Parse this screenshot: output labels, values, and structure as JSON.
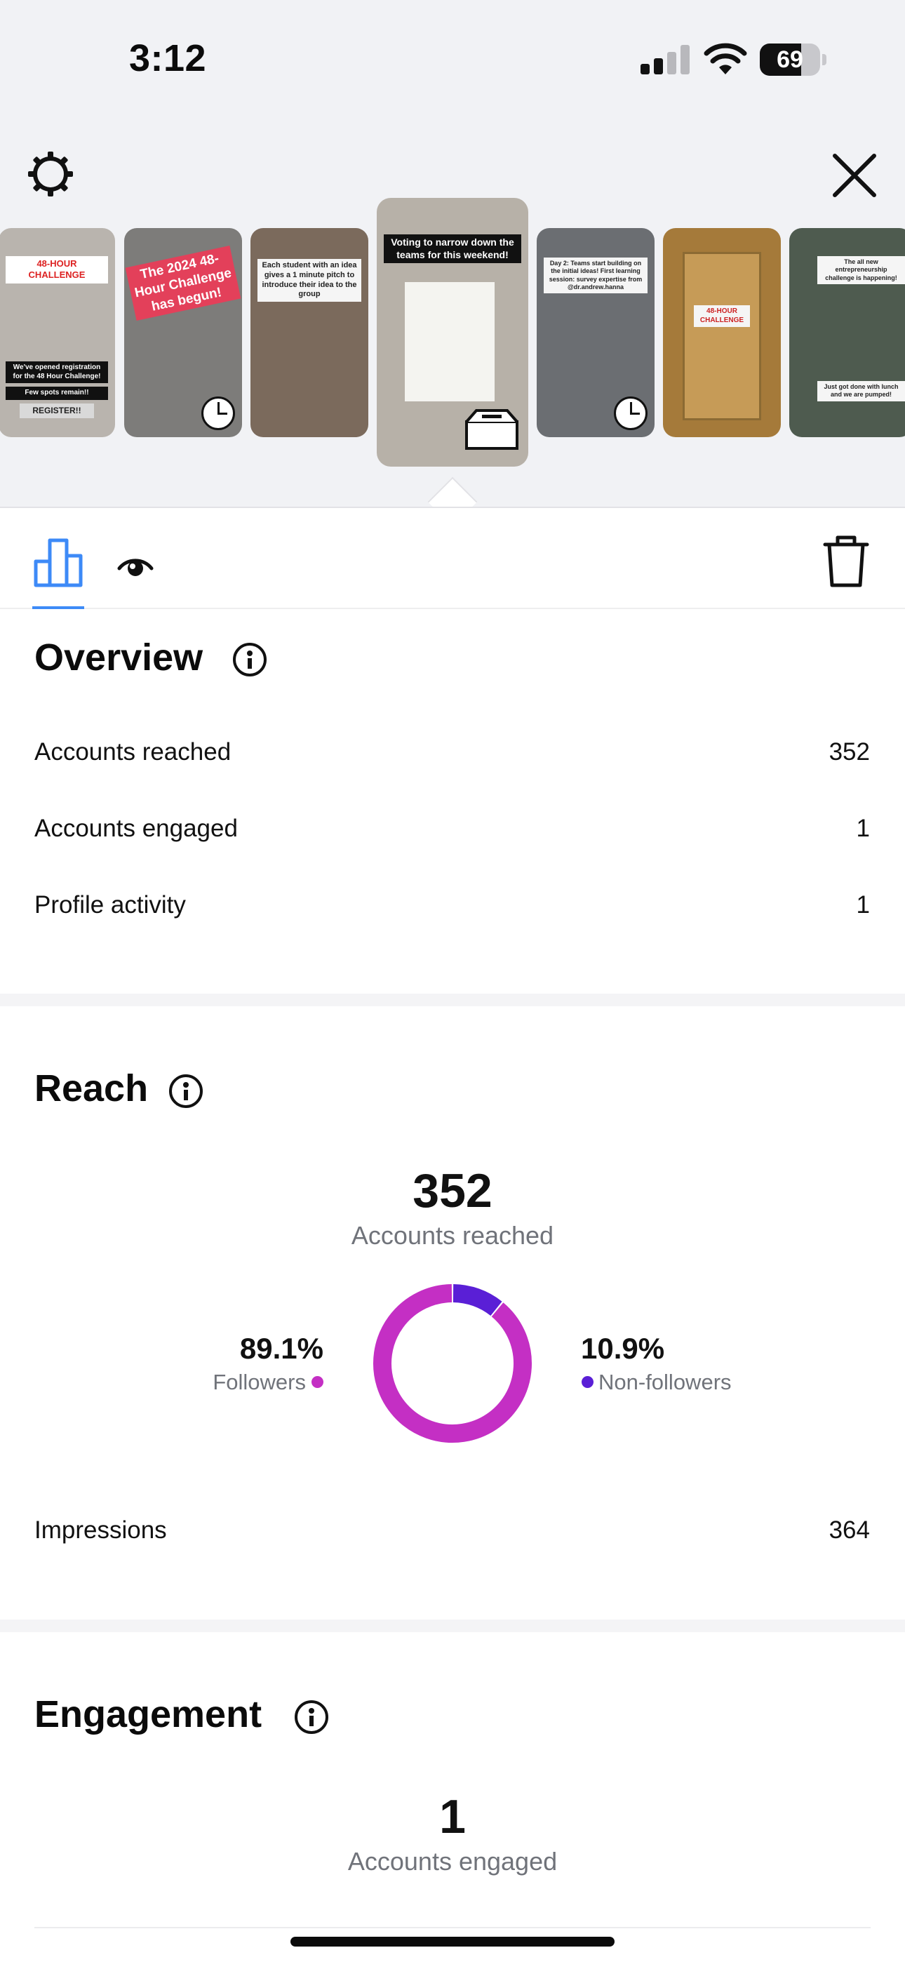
{
  "status_bar": {
    "time": "3:12",
    "battery": "69",
    "battery_level": 0.69
  },
  "header": {
    "settings_icon": "gear-icon",
    "close_icon": "close-icon"
  },
  "stories": [
    {
      "caption": "48-HOUR CHALLENGE",
      "caption2": "We've opened registration for the 48 Hour Challenge!",
      "caption3": "Few spots remain!!",
      "caption4": "REGISTER!!",
      "bg": "#b9b4ae"
    },
    {
      "caption": "The 2024 48-Hour Challenge has begun!",
      "bg": "#7d7c7a"
    },
    {
      "caption": "Each student with an idea gives a 1 minute pitch to introduce their idea to the group",
      "bg": "#7b6a5c"
    },
    {
      "caption": "Voting to narrow down the teams for this weekend!",
      "bg": "#b7b1a8"
    },
    {
      "caption": "Day 2: Teams start building on the initial ideas! First learning session: survey expertise from @dr.andrew.hanna",
      "bg": "#6b6e72"
    },
    {
      "caption": "48-HOUR CHALLENGE",
      "bg": "#a57a3a"
    },
    {
      "caption": "The all new entrepreneurship challenge is happening!",
      "caption2": "Just got done with lunch and we are pumped!",
      "bg": "#4e5b4f"
    }
  ],
  "tabs": {
    "insights_icon": "bar-chart-icon",
    "views_icon": "eye-icon",
    "delete_icon": "trash-icon"
  },
  "overview": {
    "title": "Overview",
    "rows": [
      {
        "label": "Accounts reached",
        "value": "352"
      },
      {
        "label": "Accounts engaged",
        "value": "1"
      },
      {
        "label": "Profile activity",
        "value": "1"
      }
    ]
  },
  "reach": {
    "title": "Reach",
    "total": "352",
    "total_label": "Accounts reached",
    "followers_pct": "89.1%",
    "followers_label": "Followers",
    "non_followers_pct": "10.9%",
    "non_followers_label": "Non-followers",
    "followers_fraction": 0.891,
    "non_followers_fraction": 0.109,
    "colors": {
      "followers": "#c42fc4",
      "non_followers": "#5a1fd6"
    },
    "impressions_label": "Impressions",
    "impressions_value": "364"
  },
  "engagement": {
    "title": "Engagement",
    "total": "1",
    "total_label": "Accounts engaged"
  }
}
